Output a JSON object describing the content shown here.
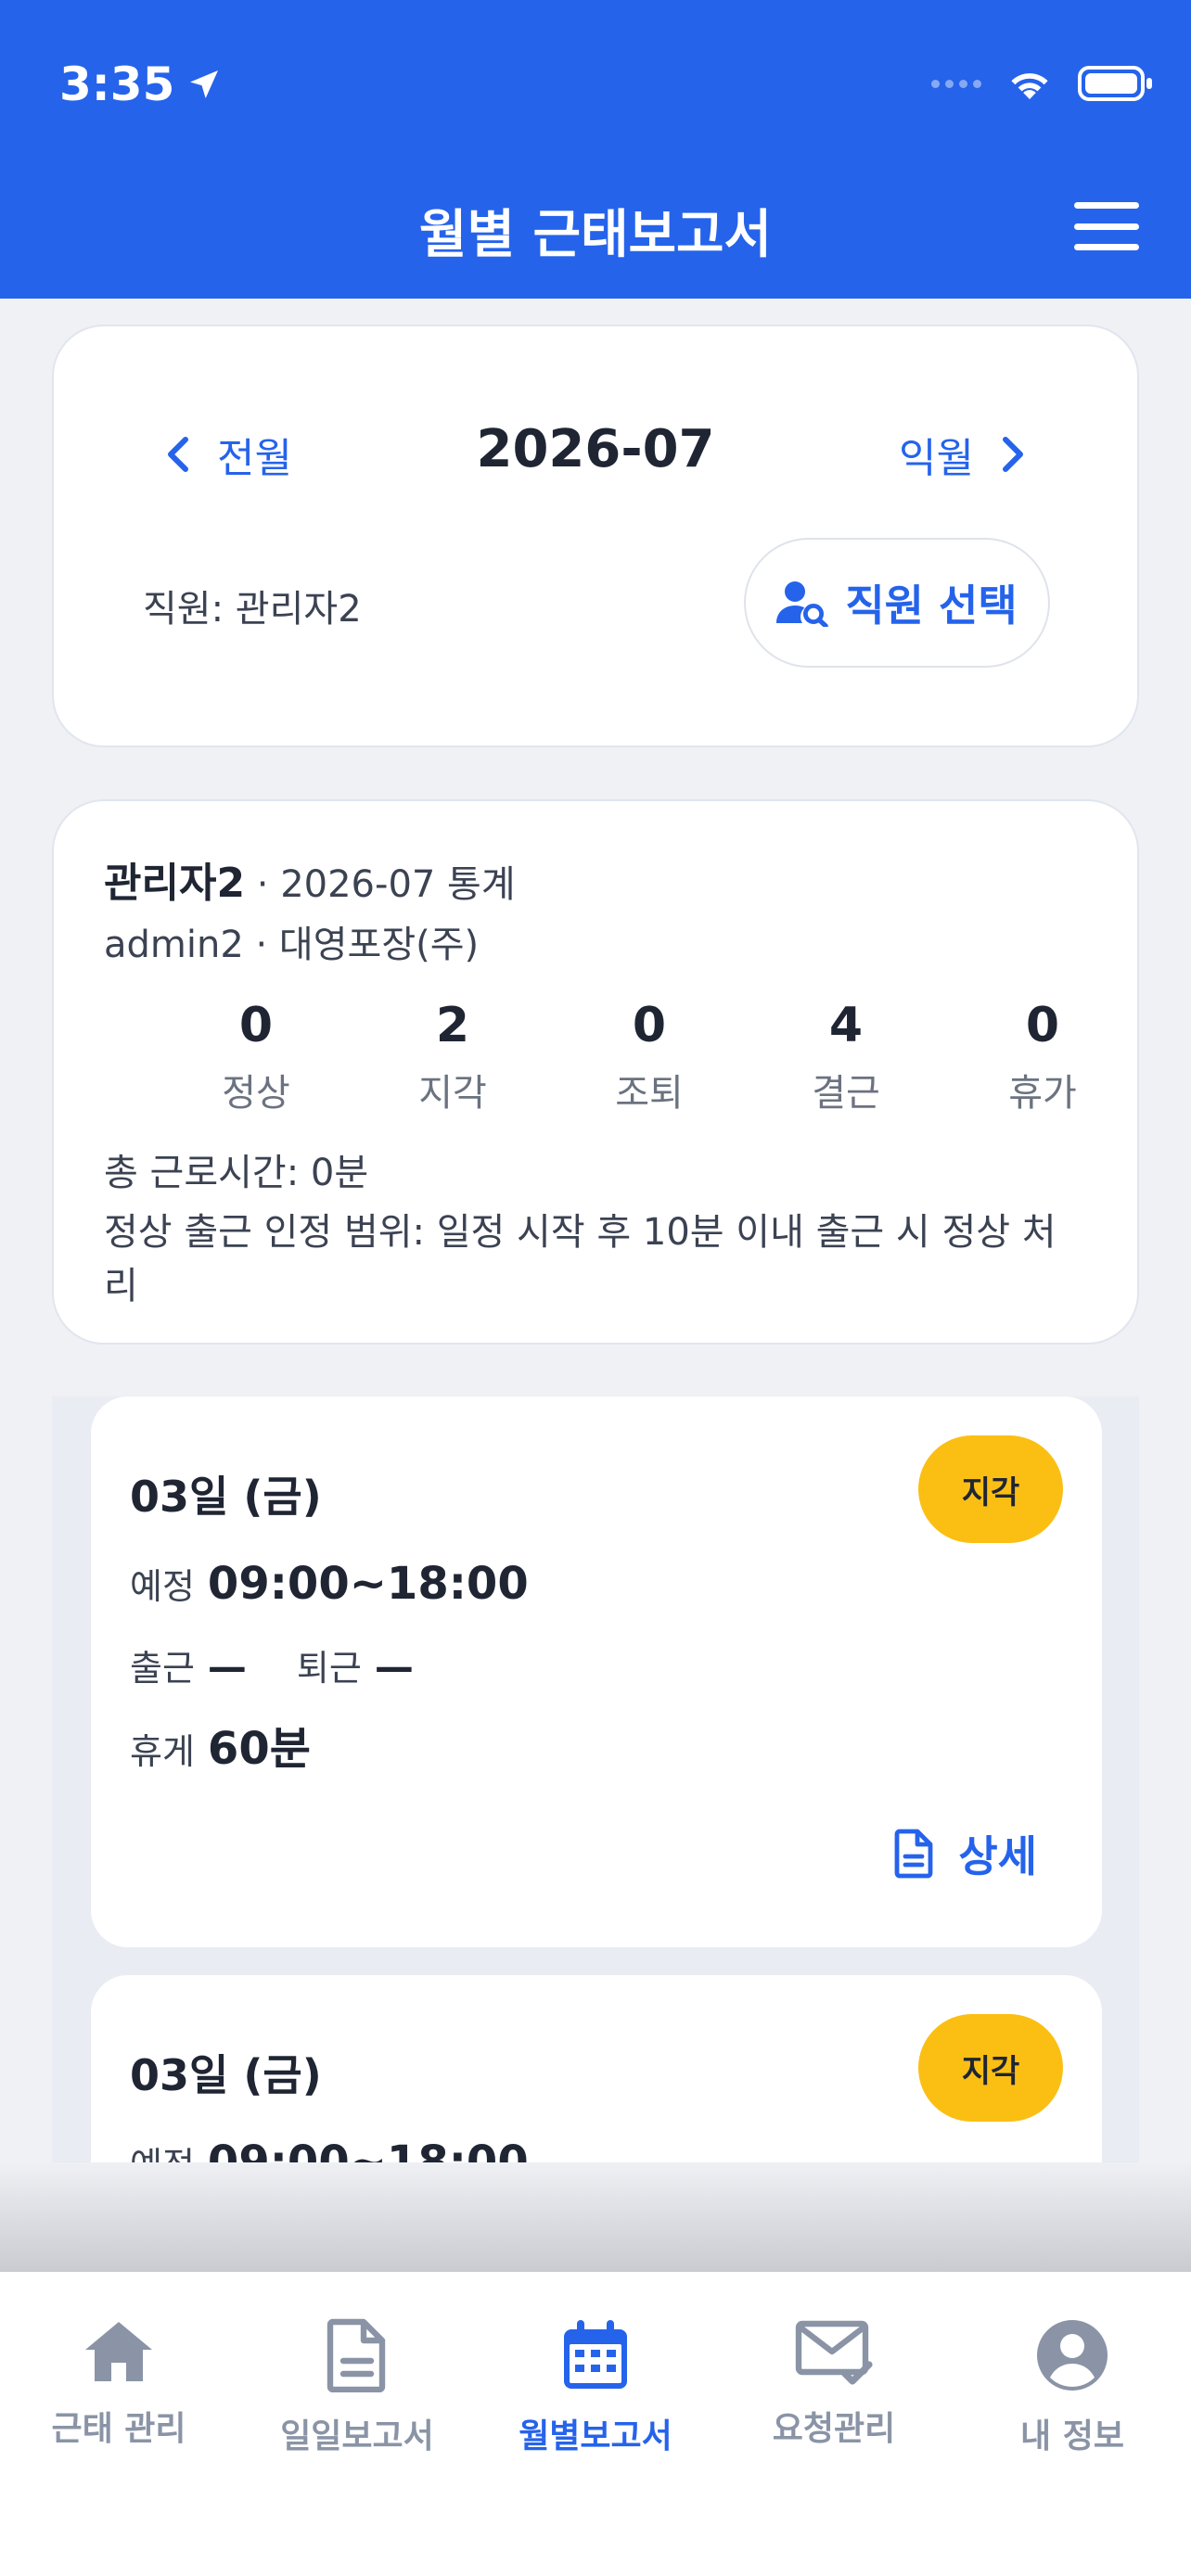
{
  "status_bar": {
    "time": "3:35"
  },
  "header": {
    "title": "월별 근태보고서"
  },
  "month_nav": {
    "prev_label": "전월",
    "next_label": "익월",
    "current_month": "2026-07",
    "employee_label": "직원: 관리자2",
    "select_employee_label": "직원 선택"
  },
  "stats": {
    "name": "관리자2",
    "period": " · 2026-07 통계",
    "sub": "admin2 · 대영포장(주)",
    "items": [
      {
        "value": "0",
        "label": "정상"
      },
      {
        "value": "2",
        "label": "지각"
      },
      {
        "value": "0",
        "label": "조퇴"
      },
      {
        "value": "4",
        "label": "결근"
      },
      {
        "value": "0",
        "label": "휴가"
      }
    ],
    "total_hours": "총 근로시간: 0분",
    "policy": "정상 출근 인정 범위: 일정 시작 후 10분 이내 출근 시 정상 처리"
  },
  "records": [
    {
      "date": "03일 (금)",
      "badge": "지각",
      "schedule_label": "예정",
      "schedule": "09:00~18:00",
      "in_label": "출근",
      "in_value": "—",
      "out_label": "퇴근",
      "out_value": "—",
      "break_label": "휴게",
      "break_value": "60분",
      "detail_label": "상세"
    },
    {
      "date": "03일 (금)",
      "badge": "지각",
      "schedule_label": "예정",
      "schedule": "09:00~18:00"
    }
  ],
  "tabs": [
    {
      "label": "근태 관리",
      "icon": "home-icon"
    },
    {
      "label": "일일보고서",
      "icon": "document-icon"
    },
    {
      "label": "월별보고서",
      "icon": "calendar-icon"
    },
    {
      "label": "요청관리",
      "icon": "mail-check-icon"
    },
    {
      "label": "내 정보",
      "icon": "user-circle-icon"
    }
  ],
  "colors": {
    "primary": "#2563eb",
    "late_badge": "#fbbf14",
    "background": "#eff1f5"
  }
}
